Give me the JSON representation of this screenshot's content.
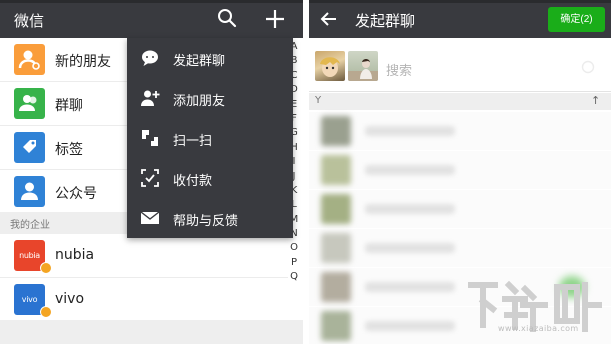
{
  "left": {
    "title": "微信",
    "contacts": [
      {
        "label": "新的朋友",
        "color": "#fa9d3b"
      },
      {
        "label": "群聊",
        "color": "#37b34a"
      },
      {
        "label": "标签",
        "color": "#2f82d6"
      },
      {
        "label": "公众号",
        "color": "#2f82d6"
      }
    ],
    "enterprise_label": "我的企业",
    "enterprise": [
      {
        "label": "nubia",
        "logo_text": "nubia",
        "color": "#e8452b"
      },
      {
        "label": "vivo",
        "logo_text": "vivo",
        "color": "#2a73d1"
      }
    ],
    "index_letters": [
      "A",
      "B",
      "C",
      "D",
      "E",
      "F",
      "G",
      "H",
      "I",
      "J",
      "K",
      "L",
      "M",
      "N",
      "O",
      "P",
      "Q"
    ],
    "menu": [
      {
        "label": "发起群聊",
        "icon": "chat-bubble-icon"
      },
      {
        "label": "添加朋友",
        "icon": "add-friend-icon"
      },
      {
        "label": "扫一扫",
        "icon": "scan-icon"
      },
      {
        "label": "收付款",
        "icon": "payment-icon"
      },
      {
        "label": "帮助与反馈",
        "icon": "mail-icon"
      }
    ]
  },
  "right": {
    "title": "发起群聊",
    "confirm_label": "确定(2)",
    "search_placeholder": "搜索",
    "section_letter": "Y",
    "sort_arrow": "↑"
  },
  "watermark": {
    "url": "www.xiazaiba.com"
  },
  "colors": {
    "topbar": "#393a3f",
    "accent_green": "#1aad19"
  }
}
